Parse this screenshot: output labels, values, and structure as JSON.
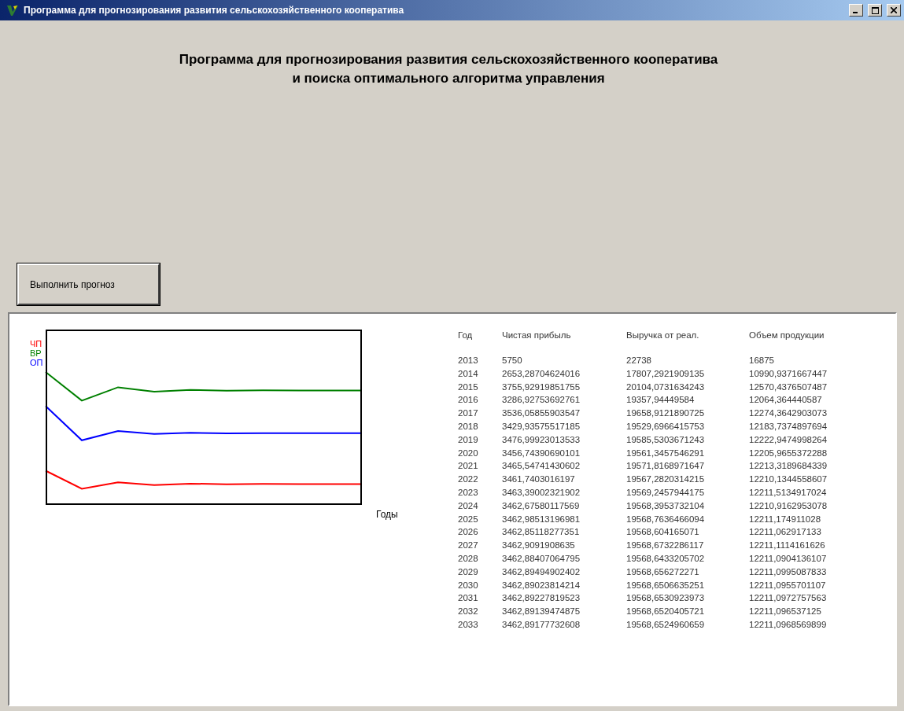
{
  "window": {
    "title": "Программа для прогнозирования развития сельскохозяйственного кооператива"
  },
  "heading": [
    "Программа для прогнозирования развития сельскохозяйственного кооператива",
    "и поиска оптимального алгоритма управления"
  ],
  "run_button": {
    "label": "Выполнить прогноз"
  },
  "chart": {
    "legend": [
      {
        "label": "ЧП",
        "color": "#ff0000"
      },
      {
        "label": "ВР",
        "color": "#008000"
      },
      {
        "label": "ОП",
        "color": "#0000ff"
      }
    ],
    "xlabel": "Годы"
  },
  "table": {
    "columns": [
      "Год",
      "Чистая прибыль",
      "Выручка от реал.",
      "Объем продукции"
    ],
    "rows": [
      [
        "2013",
        "5750",
        "22738",
        "16875"
      ],
      [
        "2014",
        "2653,28704624016",
        "17807,2921909135",
        "10990,9371667447"
      ],
      [
        "2015",
        "3755,92919851755",
        "20104,0731634243",
        "12570,4376507487"
      ],
      [
        "2016",
        "3286,92753692761",
        "19357,94449584",
        "12064,364440587"
      ],
      [
        "2017",
        "3536,05855903547",
        "19658,9121890725",
        "12274,3642903073"
      ],
      [
        "2018",
        "3429,93575517185",
        "19529,6966415753",
        "12183,7374897694"
      ],
      [
        "2019",
        "3476,99923013533",
        "19585,5303671243",
        "12222,9474998264"
      ],
      [
        "2020",
        "3456,74390690101",
        "19561,3457546291",
        "12205,9655372288"
      ],
      [
        "2021",
        "3465,54741430602",
        "19571,8168971647",
        "12213,3189684339"
      ],
      [
        "2022",
        "3461,7403016197",
        "19567,2820314215",
        "12210,1344558607"
      ],
      [
        "2023",
        "3463,39002321902",
        "19569,2457944175",
        "12211,5134917024"
      ],
      [
        "2024",
        "3462,67580117569",
        "19568,3953732104",
        "12210,9162953078"
      ],
      [
        "2025",
        "3462,98513196981",
        "19568,7636466094",
        "12211,174911028"
      ],
      [
        "2026",
        "3462,85118277351",
        "19568,604165071",
        "12211,062917133"
      ],
      [
        "2027",
        "3462,9091908635",
        "19568,6732286117",
        "12211,1114161626"
      ],
      [
        "2028",
        "3462,88407064795",
        "19568,6433205702",
        "12211,0904136107"
      ],
      [
        "2029",
        "3462,89494902402",
        "19568,656272271",
        "12211,0995087833"
      ],
      [
        "2030",
        "3462,89023814214",
        "19568,6506635251",
        "12211,0955701107"
      ],
      [
        "2031",
        "3462,89227819523",
        "19568,6530923973",
        "12211,0972757563"
      ],
      [
        "2032",
        "3462,89139474875",
        "19568,6520405721",
        "12211,096537125"
      ],
      [
        "2033",
        "3462,89177732608",
        "19568,6524960659",
        "12211,0968569899"
      ]
    ]
  }
}
